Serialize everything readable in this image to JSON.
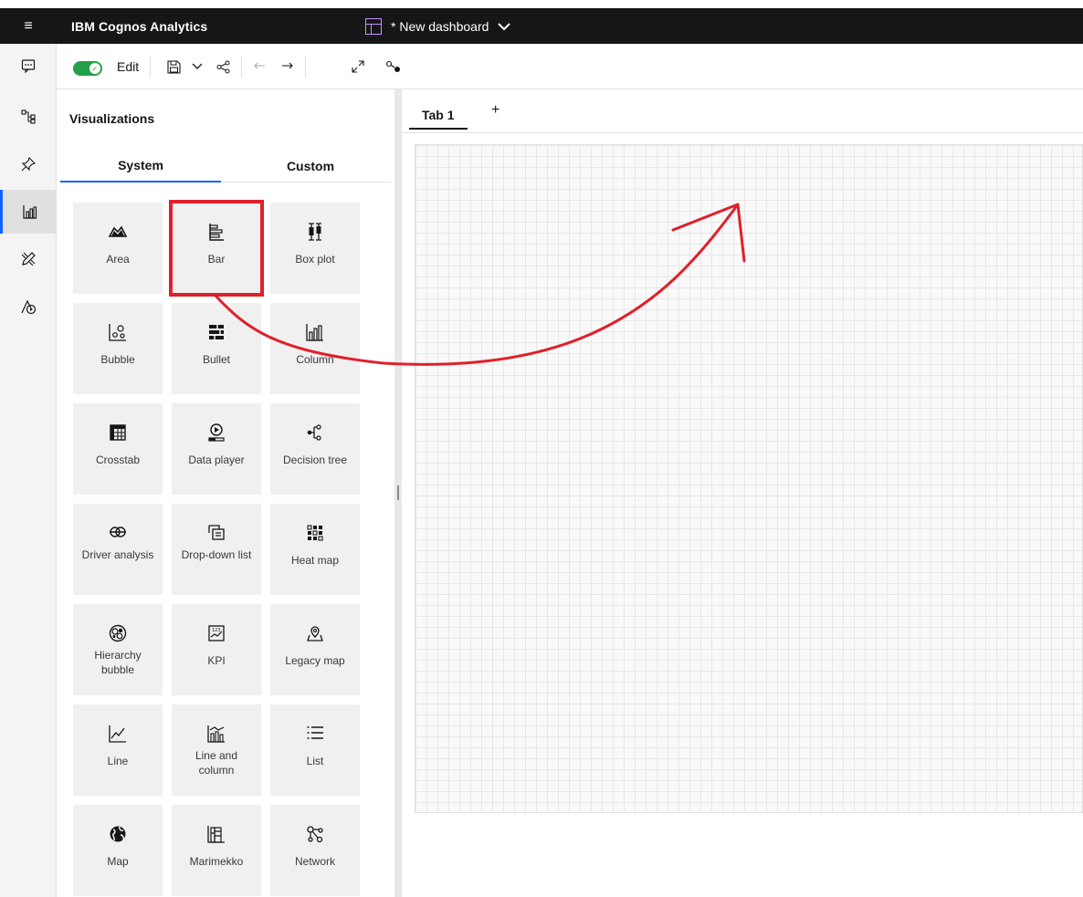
{
  "header": {
    "app_title": "IBM Cognos Analytics",
    "dashboard_title": "* New dashboard"
  },
  "toolbar": {
    "edit_label": "Edit",
    "edit_enabled": true,
    "accent_color": "#24a148"
  },
  "panel": {
    "title": "Visualizations",
    "tabs": [
      {
        "label": "System",
        "selected": true
      },
      {
        "label": "Custom",
        "selected": false
      }
    ],
    "tiles": [
      {
        "label": "Area",
        "icon": "area-chart-icon"
      },
      {
        "label": "Bar",
        "icon": "bar-chart-icon"
      },
      {
        "label": "Box plot",
        "icon": "box-plot-icon"
      },
      {
        "label": "Bubble",
        "icon": "bubble-chart-icon"
      },
      {
        "label": "Bullet",
        "icon": "bullet-chart-icon"
      },
      {
        "label": "Column",
        "icon": "column-chart-icon"
      },
      {
        "label": "Crosstab",
        "icon": "crosstab-icon"
      },
      {
        "label": "Data player",
        "icon": "data-player-icon"
      },
      {
        "label": "Decision tree",
        "icon": "decision-tree-icon"
      },
      {
        "label": "Driver analysis",
        "icon": "driver-analysis-icon"
      },
      {
        "label": "Drop-down list",
        "icon": "drop-down-list-icon"
      },
      {
        "label": "Heat map",
        "icon": "heat-map-icon"
      },
      {
        "label": "Hierarchy bubble",
        "icon": "hierarchy-bubble-icon"
      },
      {
        "label": "KPI",
        "icon": "kpi-icon"
      },
      {
        "label": "Legacy map",
        "icon": "legacy-map-icon"
      },
      {
        "label": "Line",
        "icon": "line-chart-icon"
      },
      {
        "label": "Line and column",
        "icon": "line-and-column-icon"
      },
      {
        "label": "List",
        "icon": "list-icon"
      },
      {
        "label": "Map",
        "icon": "globe-icon"
      },
      {
        "label": "Marimekko",
        "icon": "marimekko-icon"
      },
      {
        "label": "Network",
        "icon": "network-icon"
      }
    ]
  },
  "canvas": {
    "tabs": [
      {
        "label": "Tab 1",
        "selected": true
      }
    ],
    "add_tab": "+"
  },
  "annotation": {
    "highlighted_tile": "Bar",
    "color": "#e0202a"
  },
  "colors": {
    "header_bg": "#161616",
    "accent_blue": "#0f62fe",
    "dashboard_icon": "#c491ff"
  }
}
